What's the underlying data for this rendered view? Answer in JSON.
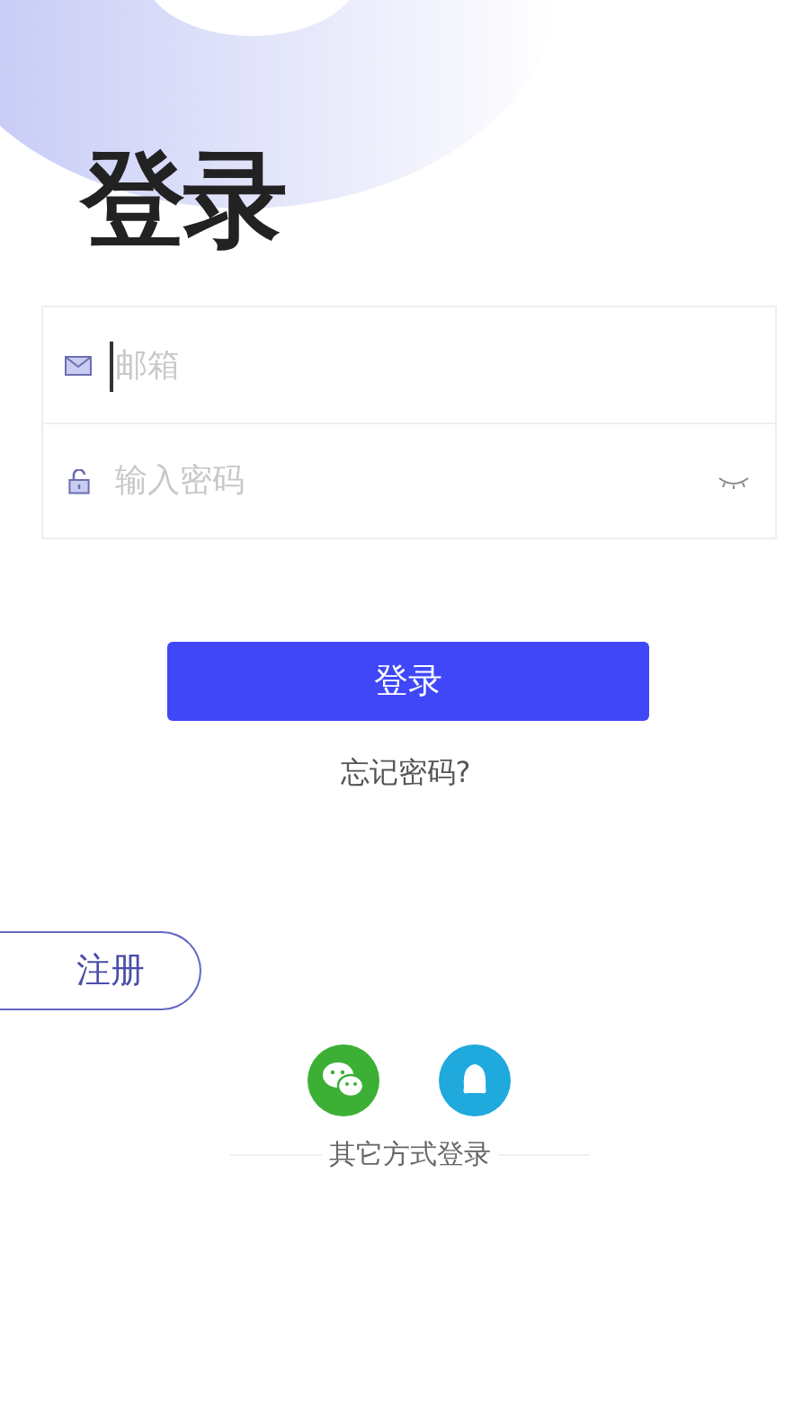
{
  "title": "登录",
  "fields": [
    {
      "kind": "email",
      "placeholder": "邮箱",
      "focused": true
    },
    {
      "kind": "password",
      "placeholder": "输入密码",
      "focused": false
    }
  ],
  "login_button": "登录",
  "forgot_link": "忘记密码?",
  "register_button": "注册",
  "social_logins": [
    {
      "kind": "wechat"
    },
    {
      "kind": "qq"
    }
  ],
  "other_login_label": "其它方式登录"
}
